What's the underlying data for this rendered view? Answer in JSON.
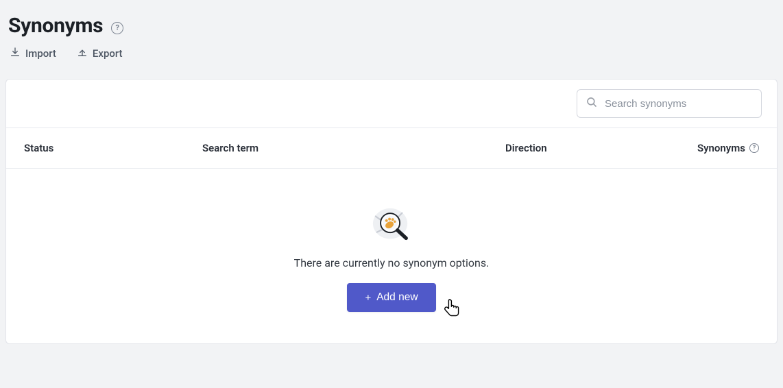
{
  "header": {
    "title": "Synonyms"
  },
  "actions": {
    "import_label": "Import",
    "export_label": "Export"
  },
  "search": {
    "placeholder": "Search synonyms"
  },
  "columns": {
    "status": "Status",
    "search_term": "Search term",
    "direction": "Direction",
    "synonyms": "Synonyms"
  },
  "empty": {
    "message": "There are currently no synonym options.",
    "add_button": "Add new"
  }
}
